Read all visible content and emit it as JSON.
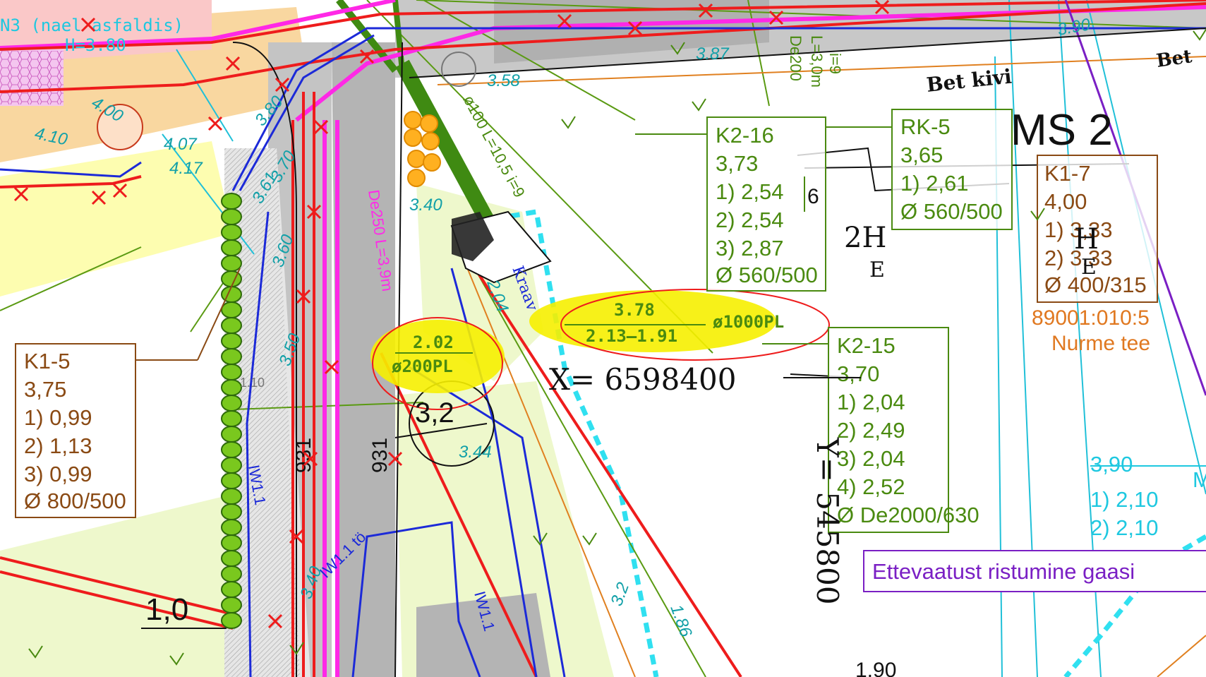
{
  "colors": {
    "green": "#4a8a10",
    "brown": "#8a4a14",
    "orange": "#e07820",
    "cyan": "#1ec8e0",
    "teal": "#12a0a8",
    "red": "#ee1c1c",
    "blue": "#1c2ad8",
    "magenta": "#ff2ae8",
    "purple": "#7a1fc4",
    "highlight": "#f6f000",
    "road_gray": "#b4b4b4",
    "pale_green": "#eef8cc",
    "pale_yellow": "#fdfdb0"
  },
  "wells": {
    "k2_16": {
      "id": "K2-16",
      "top": "3,73",
      "l1": "1) 2,54",
      "l2": "2) 2,54",
      "l3": "3) 2,87",
      "dia": "Ø 560/500"
    },
    "rk_5": {
      "id": "RK-5",
      "top": "3,65",
      "l1": "1) 2,61",
      "dia": "Ø 560/500"
    },
    "k1_7": {
      "id": "K1-7",
      "top": "4,00",
      "l1": "1) 3,33",
      "l2": "2) 3,33",
      "dia": "Ø 400/315"
    },
    "k1_5": {
      "id": "K1-5",
      "top": "3,75",
      "l1": "1) 0,99",
      "l2": "2) 1,13",
      "l3": "3) 0,99",
      "dia": "Ø 800/500"
    },
    "k2_15": {
      "id": "K2-15",
      "top": "3,70",
      "l1": "1) 2,04",
      "l2": "2) 2,49",
      "l3": "3) 2,04",
      "l4": "4) 2,52",
      "dia": "Ø De2000/630"
    },
    "right_cyan": {
      "top": "3,90",
      "l1": "1) 2,10",
      "l2": "2) 2,10"
    }
  },
  "highlights": {
    "pipe_large": {
      "top": "3.78",
      "bottom": "2.13–1.91",
      "dia": "ø1000PL"
    },
    "pipe_small": {
      "top": "2.02",
      "dia": "ø200PL"
    }
  },
  "coordinates": {
    "x_label": "X=  6598400",
    "y_label": "Y=  545800"
  },
  "notes": {
    "warning": "Ettevaatust ristumine gaasi",
    "parcel_id": "89001:010:5",
    "parcel_street": "Nurme  tee",
    "bet_kivi": "Bet  kivi",
    "bet_corner": "Bet",
    "ms2": "MS 2",
    "ditch": "Kraav",
    "n3_label": "N3 (nael asfaldis)",
    "n3_height": "H=3.80",
    "two_h": "2H",
    "h_letter": "H",
    "e_letter_1": "E",
    "e_letter_2": "E",
    "six": "6",
    "three_two": "3,2",
    "one_zero": "1,0",
    "nine_three_one_a": "931",
    "nine_three_one_b": "931",
    "de200": "De200",
    "l3m": "L=3,0m",
    "i9": "i=9",
    "d100": "ø100 L=10,5 i=9",
    "de250": "De250 L=3,9m",
    "one_ninety": "1,90",
    "neg_1_86": "1.86",
    "iw1": "IW1.1",
    "iw1b": "IW1.1 tö",
    "iw1c": "IW1.1",
    "m_cut": "M"
  },
  "elevations": {
    "e3_58": "3.58",
    "e3_87": "3.87",
    "e3_40": "3.40",
    "e2_04": "2.04",
    "e3_44": "3.44",
    "e4_07": "4.07",
    "e4_17": "4.17",
    "e4_10": "4.10",
    "e4_00": "4.00",
    "e3_80": "3.80",
    "e3_61": "3.61",
    "e3_70": "3.70",
    "e3_60": "3.60",
    "e3_50": "3.50",
    "e3_40b": "3.40",
    "e3_2x": "3.2",
    "e3_90_top": "3.90",
    "e1_10": "1.10"
  }
}
